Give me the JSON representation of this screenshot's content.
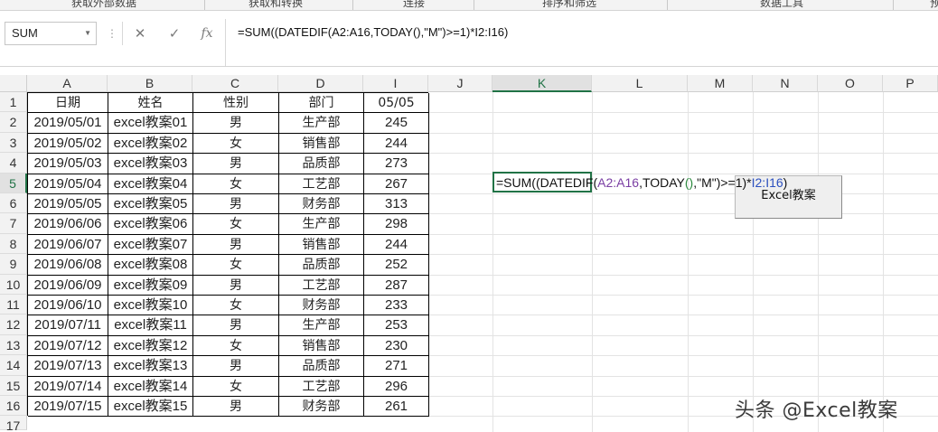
{
  "ribbon": {
    "groups": [
      "获取外部数据",
      "获取和转换",
      "连接",
      "排序和筛选",
      "数据工具",
      "预"
    ]
  },
  "formula_bar": {
    "name_box": "SUM",
    "name_box_arrow": "▼",
    "dots": "⋮",
    "cancel_glyph": "✕",
    "enter_glyph": "✓",
    "fx_glyph": "fx",
    "formula": "=SUM((DATEDIF(A2:A16,TODAY(),\"M\")>=1)*I2:I16)"
  },
  "columns": [
    {
      "id": "A",
      "label": "A"
    },
    {
      "id": "B",
      "label": "B"
    },
    {
      "id": "C",
      "label": "C"
    },
    {
      "id": "D",
      "label": "D"
    },
    {
      "id": "I",
      "label": "I"
    },
    {
      "id": "J",
      "label": "J"
    },
    {
      "id": "K",
      "label": "K"
    },
    {
      "id": "L",
      "label": "L"
    },
    {
      "id": "M",
      "label": "M"
    },
    {
      "id": "N",
      "label": "N"
    },
    {
      "id": "O",
      "label": "O"
    },
    {
      "id": "P",
      "label": "P"
    }
  ],
  "rows": [
    "1",
    "2",
    "3",
    "4",
    "5",
    "6",
    "7",
    "8",
    "9",
    "10",
    "11",
    "12",
    "13",
    "14",
    "15",
    "16",
    "17"
  ],
  "table": {
    "headers": [
      "日期",
      "姓名",
      "性别",
      "部门",
      "05/05"
    ],
    "rows": [
      [
        "2019/05/01",
        "excel教案01",
        "男",
        "生产部",
        "245"
      ],
      [
        "2019/05/02",
        "excel教案02",
        "女",
        "销售部",
        "244"
      ],
      [
        "2019/05/03",
        "excel教案03",
        "男",
        "品质部",
        "273"
      ],
      [
        "2019/05/04",
        "excel教案04",
        "女",
        "工艺部",
        "267"
      ],
      [
        "2019/05/05",
        "excel教案05",
        "男",
        "财务部",
        "313"
      ],
      [
        "2019/06/06",
        "excel教案06",
        "女",
        "生产部",
        "298"
      ],
      [
        "2019/06/07",
        "excel教案07",
        "男",
        "销售部",
        "244"
      ],
      [
        "2019/06/08",
        "excel教案08",
        "女",
        "品质部",
        "252"
      ],
      [
        "2019/06/09",
        "excel教案09",
        "男",
        "工艺部",
        "287"
      ],
      [
        "2019/06/10",
        "excel教案10",
        "女",
        "财务部",
        "233"
      ],
      [
        "2019/07/11",
        "excel教案11",
        "男",
        "生产部",
        "253"
      ],
      [
        "2019/07/12",
        "excel教案12",
        "女",
        "销售部",
        "230"
      ],
      [
        "2019/07/13",
        "excel教案13",
        "男",
        "品质部",
        "271"
      ],
      [
        "2019/07/14",
        "excel教案14",
        "女",
        "工艺部",
        "296"
      ],
      [
        "2019/07/15",
        "excel教案15",
        "男",
        "财务部",
        "261"
      ]
    ]
  },
  "editing_cell": {
    "part1": "=SUM((DATEDIF(",
    "part2": "A2:A16",
    "part3": ",TODAY",
    "part4": "()",
    "part5": ",\"M\")>=1)*",
    "part6": "I2:I16",
    "part7": ")"
  },
  "form_button": {
    "label": "Excel教案"
  },
  "watermark": "头条 @Excel教案",
  "colors": {
    "selection": "#217346",
    "ref_purple": "#7a3ea3",
    "ref_blue": "#2b4fbf",
    "ref_green": "#2c8a3f"
  }
}
